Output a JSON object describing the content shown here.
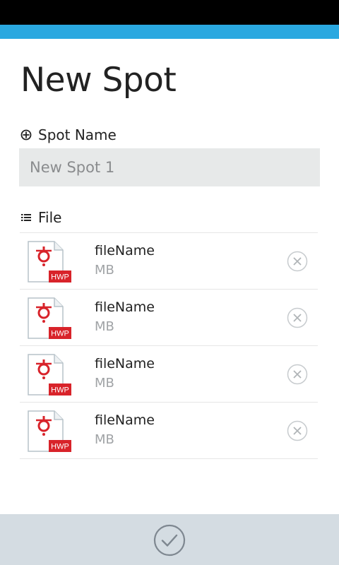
{
  "colors": {
    "accent": "#2aa8e0",
    "hwp_badge": "#d8232a",
    "input_bg": "#e7e9e9",
    "bottom_bar": "#d4dce2"
  },
  "header": {
    "title": "New Spot"
  },
  "spot_name": {
    "label": "Spot Name",
    "icon": "crosshair-icon",
    "value": "New Spot 1"
  },
  "files": {
    "label": "File",
    "icon": "list-icon",
    "items": [
      {
        "name": "fileName",
        "size": "MB",
        "badge": "HWP"
      },
      {
        "name": "fileName",
        "size": "MB",
        "badge": "HWP"
      },
      {
        "name": "fileName",
        "size": "MB",
        "badge": "HWP"
      },
      {
        "name": "fileName",
        "size": "MB",
        "badge": "HWP"
      }
    ]
  },
  "footer": {
    "confirm_icon": "check-circle-icon"
  }
}
